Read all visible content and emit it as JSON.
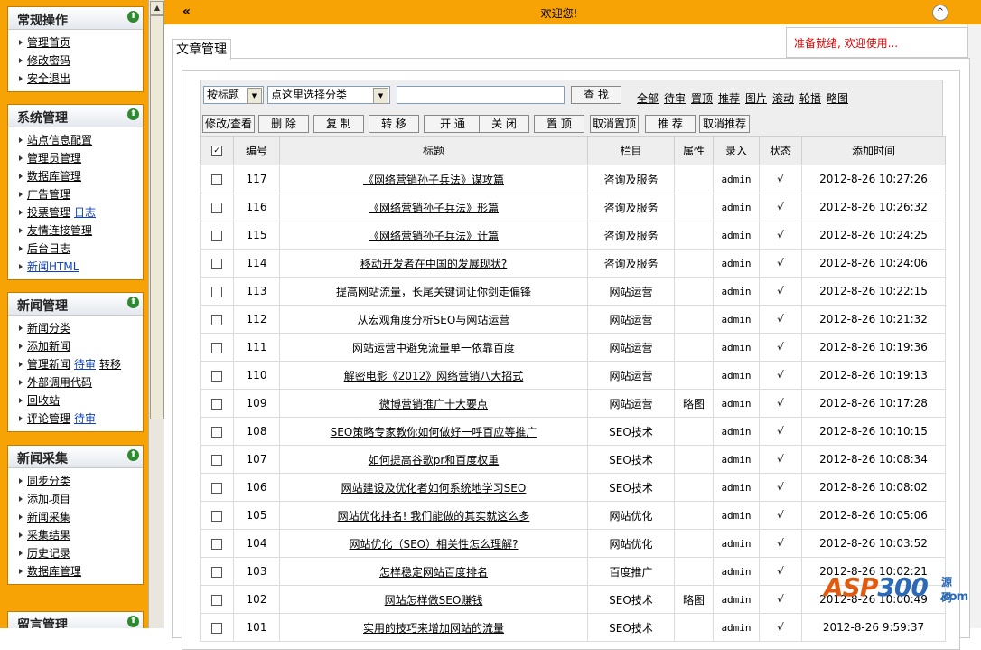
{
  "sidebar": {
    "panels": [
      {
        "title": "常规操作",
        "items": [
          [
            "管理首页"
          ],
          [
            "修改密码"
          ],
          [
            "安全退出"
          ]
        ]
      },
      {
        "title": "系统管理",
        "items": [
          [
            "站点信息配置"
          ],
          [
            "管理员管理"
          ],
          [
            "数据库管理"
          ],
          [
            "广告管理"
          ],
          [
            "投票管理",
            "日志"
          ],
          [
            "友情连接管理"
          ],
          [
            "后台日志"
          ],
          [
            "新闻HTML"
          ]
        ]
      },
      {
        "title": "新闻管理",
        "items": [
          [
            "新闻分类"
          ],
          [
            "添加新闻"
          ],
          [
            "管理新闻",
            "待审",
            "转移"
          ],
          [
            "外部调用代码"
          ],
          [
            "回收站"
          ],
          [
            "评论管理",
            "待审"
          ]
        ]
      },
      {
        "title": "新闻采集",
        "items": [
          [
            "同步分类"
          ],
          [
            "添加项目"
          ],
          [
            "新闻采集"
          ],
          [
            "采集结果"
          ],
          [
            "历史记录"
          ],
          [
            "数据库管理"
          ]
        ]
      },
      {
        "title": "留言管理",
        "items": []
      }
    ]
  },
  "topbar": {
    "collapse": "«",
    "welcome": "欢迎您!",
    "up": "^"
  },
  "tab_title": "文章管理",
  "status": "准备就绪, 欢迎使用...",
  "toolbar": {
    "search_by": "按标题",
    "category": "点这里选择分类",
    "search_btn": "查 找",
    "filters": [
      "全部",
      "待审",
      "置顶",
      "推荐",
      "图片",
      "滚动",
      "轮播",
      "略图"
    ],
    "actions": [
      "修改/查看",
      "删 除",
      "复 制",
      "转 移",
      "开 通",
      "关 闭",
      "置 顶",
      "取消置顶",
      "推 荐",
      "取消推荐"
    ]
  },
  "table": {
    "headers": [
      "",
      "编号",
      "标题",
      "栏目",
      "属性",
      "录入",
      "状态",
      "添加时间"
    ],
    "rows": [
      {
        "id": "117",
        "title": "《网络营销孙子兵法》谋攻篇",
        "cat": "咨询及服务",
        "attr": "",
        "user": "admin",
        "status": "√",
        "time": "2012-8-26 10:27:26"
      },
      {
        "id": "116",
        "title": "《网络营销孙子兵法》形篇",
        "cat": "咨询及服务",
        "attr": "",
        "user": "admin",
        "status": "√",
        "time": "2012-8-26 10:26:32"
      },
      {
        "id": "115",
        "title": "《网络营销孙子兵法》计篇",
        "cat": "咨询及服务",
        "attr": "",
        "user": "admin",
        "status": "√",
        "time": "2012-8-26 10:24:25"
      },
      {
        "id": "114",
        "title": "移动开发者在中国的发展现状?",
        "cat": "咨询及服务",
        "attr": "",
        "user": "admin",
        "status": "√",
        "time": "2012-8-26 10:24:06"
      },
      {
        "id": "113",
        "title": "提高网站流量，长尾关键词让你剑走偏锋",
        "cat": "网站运营",
        "attr": "",
        "user": "admin",
        "status": "√",
        "time": "2012-8-26 10:22:15"
      },
      {
        "id": "112",
        "title": "从宏观角度分析SEO与网站运营",
        "cat": "网站运营",
        "attr": "",
        "user": "admin",
        "status": "√",
        "time": "2012-8-26 10:21:32"
      },
      {
        "id": "111",
        "title": "网站运营中避免流量单一依靠百度",
        "cat": "网站运营",
        "attr": "",
        "user": "admin",
        "status": "√",
        "time": "2012-8-26 10:19:36"
      },
      {
        "id": "110",
        "title": "解密电影《2012》网络营销八大招式",
        "cat": "网站运营",
        "attr": "",
        "user": "admin",
        "status": "√",
        "time": "2012-8-26 10:19:13"
      },
      {
        "id": "109",
        "title": "微博营销推广十大要点",
        "cat": "网站运营",
        "attr": "略图",
        "user": "admin",
        "status": "√",
        "time": "2012-8-26 10:17:28"
      },
      {
        "id": "108",
        "title": "SEO策略专家教你如何做好一呼百应等推广",
        "cat": "SEO技术",
        "attr": "",
        "user": "admin",
        "status": "√",
        "time": "2012-8-26 10:10:15"
      },
      {
        "id": "107",
        "title": "如何提高谷歌pr和百度权重",
        "cat": "SEO技术",
        "attr": "",
        "user": "admin",
        "status": "√",
        "time": "2012-8-26 10:08:34"
      },
      {
        "id": "106",
        "title": "网站建设及优化者如何系统地学习SEO",
        "cat": "SEO技术",
        "attr": "",
        "user": "admin",
        "status": "√",
        "time": "2012-8-26 10:08:02"
      },
      {
        "id": "105",
        "title": "网站优化排名! 我们能做的其实就这么多",
        "cat": "网站优化",
        "attr": "",
        "user": "admin",
        "status": "√",
        "time": "2012-8-26 10:05:06"
      },
      {
        "id": "104",
        "title": "网站优化（SEO）相关性怎么理解?",
        "cat": "网站优化",
        "attr": "",
        "user": "admin",
        "status": "√",
        "time": "2012-8-26 10:03:52"
      },
      {
        "id": "103",
        "title": "怎样稳定网站百度排名",
        "cat": "百度推广",
        "attr": "",
        "user": "admin",
        "status": "√",
        "time": "2012-8-26 10:02:21"
      },
      {
        "id": "102",
        "title": "网站怎样做SEO赚钱",
        "cat": "SEO技术",
        "attr": "略图",
        "user": "admin",
        "status": "√",
        "time": "2012-8-26 10:00:49"
      },
      {
        "id": "101",
        "title": "实用的技巧来增加网站的流量",
        "cat": "SEO技术",
        "attr": "",
        "user": "admin",
        "status": "√",
        "time": "2012-8-26 9:59:37"
      }
    ]
  },
  "watermark": {
    "a": "ASP",
    "b": "300",
    "sub": "源码",
    "com": ".com"
  }
}
